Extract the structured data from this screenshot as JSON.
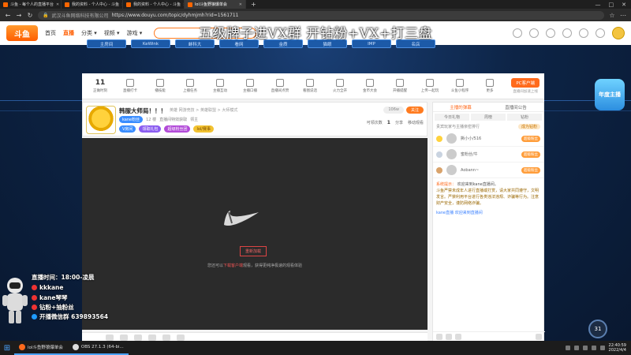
{
  "browser": {
    "tabs": [
      {
        "label": "斗鱼 - 每个人的直播平台",
        "active": false
      },
      {
        "label": "我的资料 - 个人中心 - 斗鱼",
        "active": false
      },
      {
        "label": "我的资料 - 个人中心 - 斗鱼",
        "active": false
      },
      {
        "label": "lol斗鱼野狼爆单会",
        "active": true
      }
    ],
    "new_tab": "+",
    "window_controls": [
      "—",
      "□",
      "✕"
    ],
    "url_prefix": "武汉斗鱼网络科技有限公司",
    "url": "https://www.douyu.com/topic/dyhmjmh?rid=1561711"
  },
  "site": {
    "logo": "斗鱼",
    "nav": [
      "首页",
      "直播",
      "分类 ▾",
      "视频 ▾",
      "游戏 ▾"
    ],
    "active_nav": "直播"
  },
  "overlay_banner": "五级牌子进VX群  开钻粉+VX+打三盘",
  "room_tabs": [
    "主房间",
    "KeWink",
    "蚌科大",
    "看网",
    "金质",
    "猫眼",
    "IMP",
    "名店"
  ],
  "toolbar": {
    "first_count": "11",
    "first_label": "正做时刻",
    "items": [
      "直播打卡",
      "播技能",
      "上播任务",
      "主播互动",
      "主播口播",
      "直播间点赞",
      "看图说话",
      "火力全开",
      "金币大会",
      "开播提醒",
      "上传一起玩",
      "斗鱼小程序",
      "更多"
    ],
    "pc_button": "PC客户端",
    "pc_sub": "直播间加速上线"
  },
  "room": {
    "title": "韩服大师局！！！",
    "crumbs": "英雄  网游竞技 > 英雄联盟 > 大师模式",
    "meta": [
      "kane粉丝",
      "12 楼",
      "直播间特效获取",
      "领主"
    ],
    "chips": [
      "V房间",
      "领取礼包",
      "超级粉丝团",
      "lol/赛事"
    ],
    "follow_count": "106w",
    "follow_btn": "关注",
    "views_label": "可领次数",
    "views_value": "1",
    "share": "分享",
    "report": "移动观看",
    "error_button": "重新加载",
    "error_text_prefix": "您还可以",
    "error_text_link": "下载客户端",
    "error_text_suffix": "观看，获得更纯净极速的观看体验"
  },
  "side": {
    "tabs": [
      "主播的弹幕",
      "直播间公告"
    ],
    "subtabs": [
      "今日礼物",
      "周榜",
      "钻粉"
    ],
    "rank_title": "贵宾玩家与主播亲密排行",
    "rank_btn": "成为钻粉",
    "rank": [
      {
        "name": "撕小小/516",
        "badge": "超级粉丝"
      },
      {
        "name": "蜜粉丝/牛",
        "badge": "超级粉丝"
      },
      {
        "name": "Aobann~",
        "badge": "超级粉丝"
      }
    ],
    "system_label": "系统提示：",
    "system_msg": "欢迎来到kane直播间。",
    "notice": "斗鱼严禁未成年人进行直播或打赏，请大家共同遵守，文明发言。严禁利用平台进行各类违法违规、诈骗等行为。注意财产安全，谨防网络诈骗。",
    "chat_line": "kane直播  欢迎来到直播间"
  },
  "float_badge": "年度主播",
  "speed_value": "31",
  "streamer_overlay": {
    "line1": "直播时间：18:00-凌晨",
    "line2": "kkkane",
    "line3": "kane琴琴",
    "line4": "钻粉+抽粉丝",
    "line5": "开播微信群 639893564"
  },
  "taskbar": {
    "start": "⊞",
    "apps": [
      "lol斗鱼野狼爆单会",
      "OBS 27.1.3 (64-bi..."
    ],
    "time": "22:40:59",
    "date": "2022/4/4"
  }
}
